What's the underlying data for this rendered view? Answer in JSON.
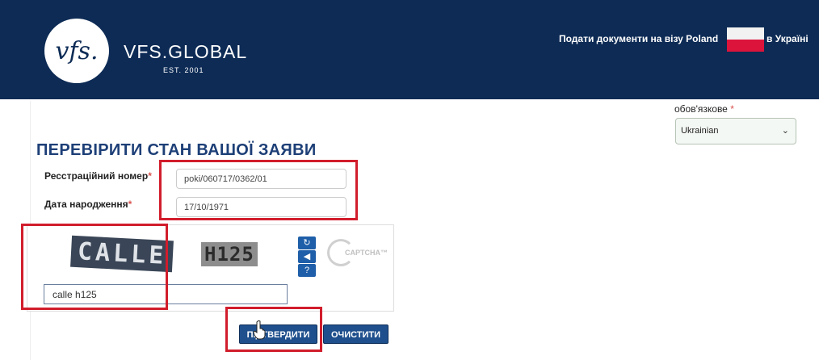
{
  "header": {
    "logo_text": "vfs.",
    "brand": "VFS.GLOBAL",
    "est": "EST. 2001",
    "text_before_flag": "Подати документи на візу Poland",
    "text_after_flag": "в Україні"
  },
  "language": {
    "label": "обов'язкове",
    "required_mark": "*",
    "value": "Ukrainian"
  },
  "form": {
    "title": "ПЕРЕВІРИТИ СТАН ВАШОЇ ЗАЯВИ",
    "reg_number_label": "Ресстраційний номер",
    "reg_number_value": "poki/060717/0362/01",
    "birth_date_label": "Дата народження",
    "birth_date_value": "17/10/1971",
    "required_mark": "*"
  },
  "captcha": {
    "word1": "CALLE",
    "word2": "H125",
    "recaptcha_text": "CAPTCHA™",
    "answer_value": "calle h125"
  },
  "buttons": {
    "submit": "ПІДТВЕРДИТИ",
    "clear": "ОЧИСТИТИ"
  },
  "colors": {
    "header_bg": "#0d2b55",
    "title": "#1d3f77",
    "highlight_box": "#d11d2c",
    "button_bg": "#1f4f8c"
  }
}
